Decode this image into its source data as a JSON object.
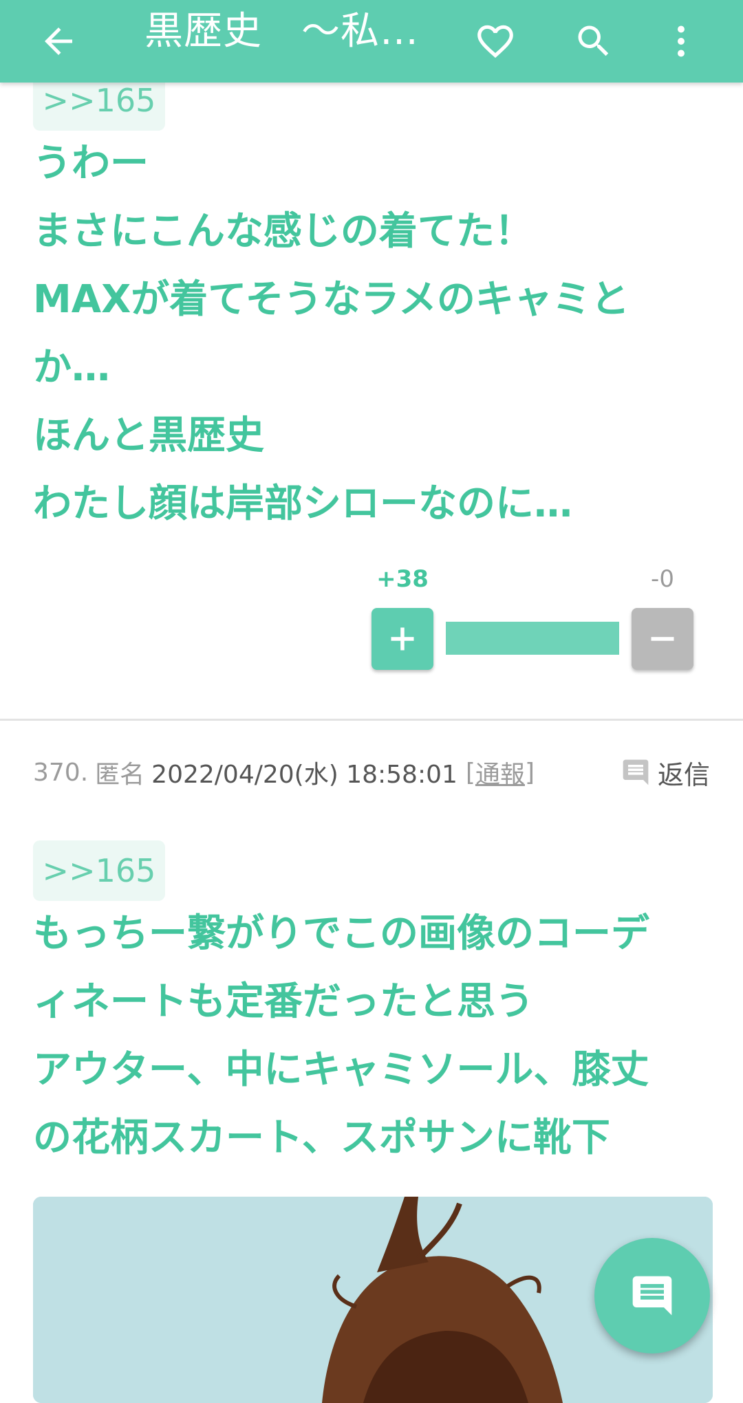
{
  "header": {
    "title": "黒歴史　〜私…",
    "back_icon": "arrow-left-icon",
    "favorite_icon": "heart-outline-icon",
    "search_icon": "search-icon",
    "menu_icon": "more-vertical-icon"
  },
  "post_369": {
    "anchor": ">>165",
    "body": "うわー\nまさにこんな感じの着てた！\nMAXが着てそうなラメのキャミと\nか…\nほんと黒歴史\nわたし顔は岸部シローなのに…",
    "vote": {
      "plus_count": "+38",
      "minus_count": "-0",
      "plus_label": "+",
      "minus_label": "−",
      "plus_ratio": 1.0
    }
  },
  "post_370": {
    "number": "370.",
    "author": "匿名",
    "datetime": "2022/04/20(水) 18:58:01",
    "report_open": "[",
    "report": "通報",
    "report_close": "]",
    "reply": "返信",
    "anchor": ">>165",
    "body": "もっちー繋がりでこの画像のコーデ\nィネートも定番だったと思う\nアウター、中にキャミソール、膝丈\nの花柄スカート、スポサンに靴下"
  },
  "fab": {
    "icon": "comment-icon"
  },
  "colors": {
    "accent": "#5ecdb0",
    "text_green": "#43c59d",
    "anchor_bg": "#ecf8f4",
    "minus_gray": "#b9b9b9"
  }
}
